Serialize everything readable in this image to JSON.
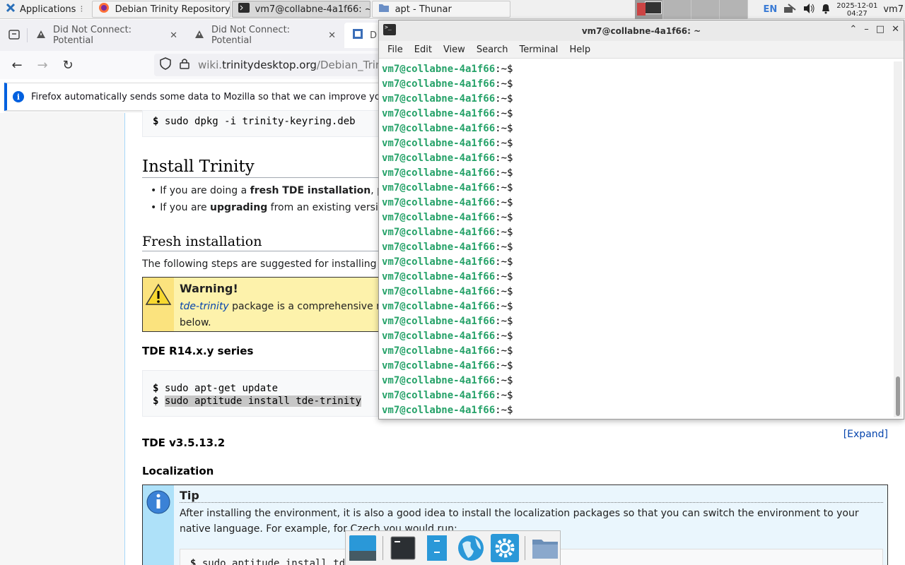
{
  "panel": {
    "applications_label": "Applications",
    "tasks": [
      {
        "label": "Debian Trinity Repository ..."
      },
      {
        "label": "vm7@collabne-4a1f66: ~"
      },
      {
        "label": "apt - Thunar"
      }
    ],
    "lang": "EN",
    "clock_date": "2025-12-01",
    "clock_time": "04:27",
    "user": "vm7"
  },
  "firefox": {
    "tabs": [
      {
        "label": "Did Not Connect: Potential"
      },
      {
        "label": "Did Not Connect: Potential"
      },
      {
        "label": "D"
      }
    ],
    "url_domain_prefix": "wiki.",
    "url_domain": "trinitydesktop.org",
    "url_path": "/Debian_Trinity_",
    "notice": "Firefox automatically sends some data to Mozilla so that we can improve your e"
  },
  "wiki": {
    "cmd_prompt": "$",
    "cmd_keyring": "sudo dpkg -i trinity-keyring.deb",
    "h_install": "Install Trinity",
    "bullet1_pre": "If you are doing a ",
    "bullet1_bold": "fresh TDE installation",
    "bullet1_post": ", pleas",
    "bullet2_pre": "If you are ",
    "bullet2_bold": "upgrading",
    "bullet2_post": " from an existing version, p",
    "h_fresh": "Fresh installation",
    "fresh_text": "The following steps are suggested for installing the",
    "warning_title": "Warning!",
    "warning_link": "tde-trinity",
    "warning_text": " package is a comprehensive meta",
    "warning_text2": "below.",
    "h_r14": "TDE R14.x.y series",
    "cmd_update": "sudo apt-get update",
    "cmd_install": "sudo aptitude install tde-trinity",
    "expand": "[Expand]",
    "h_v3": "TDE v3.5.13.2",
    "h_local": "Localization",
    "tip_title": "Tip",
    "tip_text": "After installing the environment, it is also a good idea to install the localization packages so that you can switch the environment to your native language. For example, for Czech you would run:",
    "cmd_local": "sudo aptitude install tde"
  },
  "terminal": {
    "title": "vm7@collabne-4a1f66: ~",
    "menu": [
      "File",
      "Edit",
      "View",
      "Search",
      "Terminal",
      "Help"
    ],
    "prompt_user": "vm7@collabne-4a1f66",
    "prompt_rest": ":~$",
    "line_count": 24
  },
  "dock": {
    "items": [
      "show-desktop-icon",
      "terminal-icon",
      "file-manager-icon",
      "web-browser-icon",
      "settings-icon",
      "folder-icon"
    ]
  }
}
